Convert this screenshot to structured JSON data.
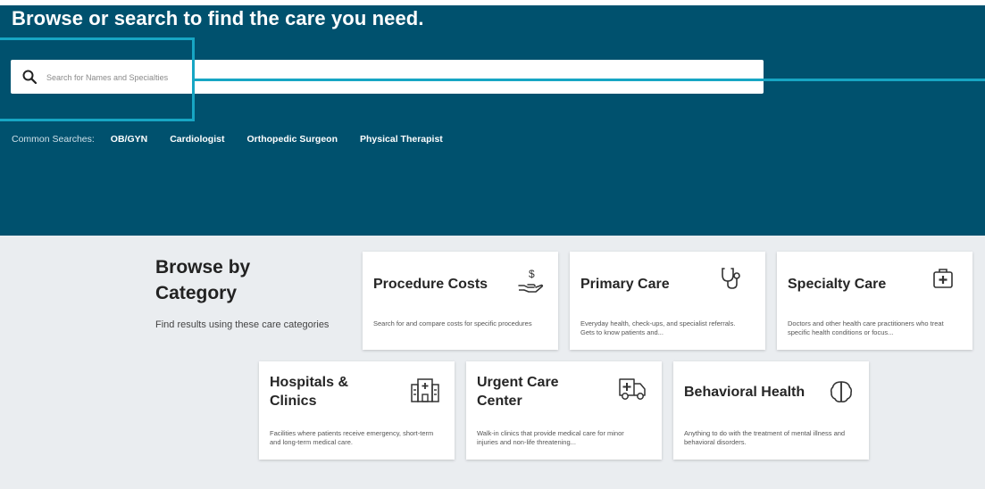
{
  "header": {
    "title": "Browse or search to find the care you need."
  },
  "search": {
    "placeholder": "Search for Names and Specialties"
  },
  "common_searches": {
    "label": "Common Searches:",
    "items": [
      "OB/GYN",
      "Cardiologist",
      "Orthopedic Surgeon",
      "Physical Therapist"
    ]
  },
  "browse": {
    "title": "Browse by Category",
    "subtitle": "Find results using these care categories"
  },
  "cards": [
    {
      "title": "Procedure Costs",
      "description": "Search for and compare costs for specific procedures",
      "icon": "hand-dollar-icon"
    },
    {
      "title": "Primary Care",
      "description": "Everyday health, check-ups, and specialist referrals. Gets to know patients and...",
      "icon": "stethoscope-icon"
    },
    {
      "title": "Specialty Care",
      "description": "Doctors and other health care practitioners who treat specific health conditions or focus...",
      "icon": "medical-kit-icon"
    },
    {
      "title": "Hospitals & Clinics",
      "description": "Facilities where patients receive emergency, short-term and long-term medical care.",
      "icon": "hospital-icon"
    },
    {
      "title": "Urgent Care Center",
      "description": "Walk-in clinics that provide medical care for minor injuries and non-life threatening...",
      "icon": "ambulance-icon"
    },
    {
      "title": "Behavioral Health",
      "description": "Anything to do with the treatment of mental illness and behavioral disorders.",
      "icon": "brain-icon"
    }
  ],
  "colors": {
    "header_bg": "#00516e",
    "highlight": "#17a6c4",
    "browse_bg": "#eaedf0"
  }
}
